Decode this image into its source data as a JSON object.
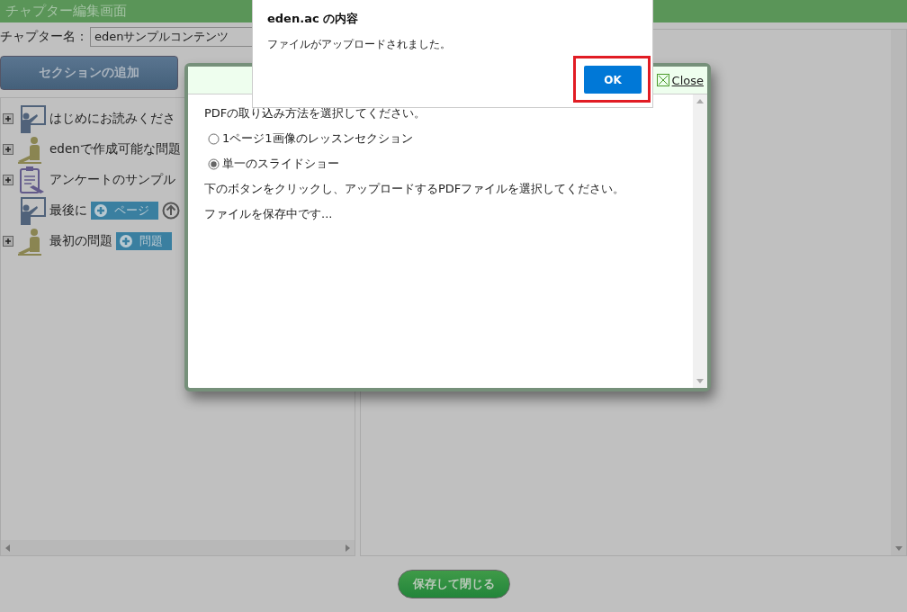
{
  "page": {
    "title": "チャプター編集画面",
    "chapter_label": "チャプター名：",
    "chapter_value": "edenサンプルコンテンツ",
    "add_section_button": "セクションの追加",
    "save_button": "保存して閉じる"
  },
  "tree": [
    {
      "kind": "teacher",
      "label": "はじめにお読みくださ",
      "expanded": false
    },
    {
      "kind": "student",
      "label": "edenで作成可能な問題",
      "expanded": false
    },
    {
      "kind": "clipboard",
      "label": "アンケートのサンプル",
      "expanded": false
    },
    {
      "kind": "teacher",
      "label": "最後に",
      "add_button": "ページ",
      "up_button": true
    },
    {
      "kind": "student",
      "label": "最初の問題",
      "expanded": false,
      "add_button": "問題"
    }
  ],
  "modal": {
    "close_link": "Close",
    "prompt": "PDFの取り込み方法を選択してください。",
    "options": [
      {
        "label": "1ページ1画像のレッスンセクション",
        "selected": false
      },
      {
        "label": "単一のスライドショー",
        "selected": true
      }
    ],
    "instruction": "下のボタンをクリックし、アップロードするPDFファイルを選択してください。",
    "status": "ファイルを保存中です..."
  },
  "alert": {
    "title": "eden.ac の内容",
    "message": "ファイルがアップロードされました。",
    "ok_button": "OK",
    "highlighted": true
  }
}
